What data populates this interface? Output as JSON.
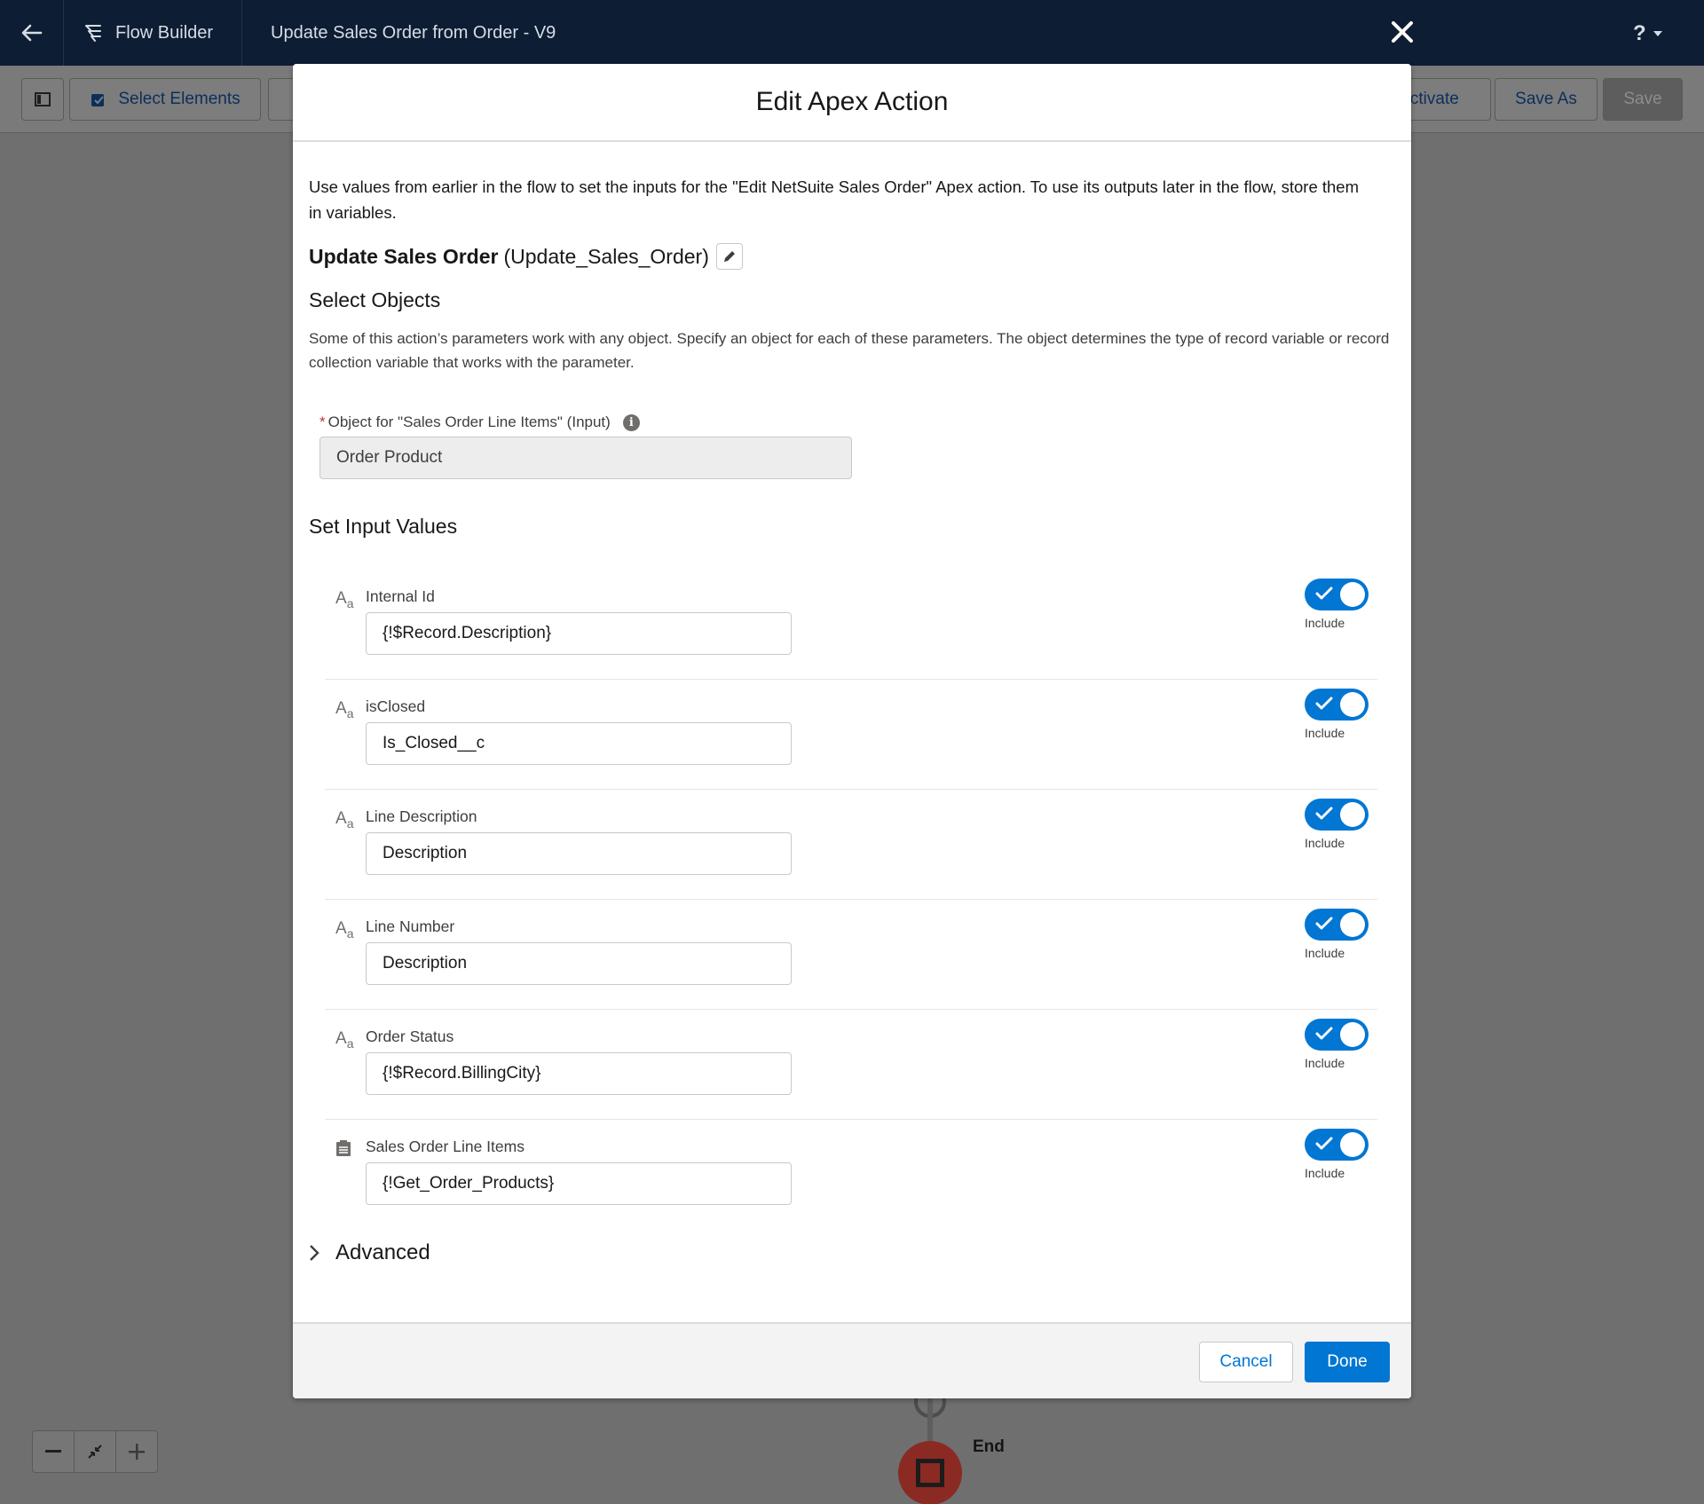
{
  "header": {
    "app_name": "Flow Builder",
    "flow_title": "Update Sales Order from Order - V9",
    "help_label": "?"
  },
  "toolbar": {
    "select_elements": "Select Elements",
    "activate": "Activate",
    "save_as": "Save As",
    "save": "Save"
  },
  "canvas": {
    "end_label": "End"
  },
  "modal": {
    "title": "Edit Apex Action",
    "intro": "Use values from earlier in the flow to set the inputs for the \"Edit NetSuite Sales Order\" Apex action. To use its outputs later in the flow, store them in variables.",
    "element_label": "Update Sales Order",
    "element_api_name": "(Update_Sales_Order)",
    "select_objects_heading": "Select Objects",
    "select_objects_help": "Some of this action’s parameters work with any object. Specify an object for each of these parameters. The object determines the type of record variable or record collection variable that works with the parameter.",
    "object_field_required": "*",
    "object_field_label": "Object for \"Sales Order Line Items\" (Input)",
    "object_field_value": "Order Product",
    "set_inputs_heading": "Set Input Values",
    "parameters": [
      {
        "type_icon": "text-type-icon",
        "label": "Internal Id",
        "value": "{!$Record.Description}",
        "include_label": "Include",
        "included": true
      },
      {
        "type_icon": "text-type-icon",
        "label": "isClosed",
        "value": "Is_Closed__c",
        "include_label": "Include",
        "included": true
      },
      {
        "type_icon": "text-type-icon",
        "label": "Line Description",
        "value": "Description",
        "include_label": "Include",
        "included": true
      },
      {
        "type_icon": "text-type-icon",
        "label": "Line Number",
        "value": "Description",
        "include_label": "Include",
        "included": true
      },
      {
        "type_icon": "text-type-icon",
        "label": "Order Status",
        "value": "{!$Record.BillingCity}",
        "include_label": "Include",
        "included": true
      },
      {
        "type_icon": "collection-icon",
        "label": "Sales Order Line Items",
        "value": "{!Get_Order_Products}",
        "include_label": "Include",
        "included": true
      }
    ],
    "advanced_label": "Advanced",
    "cancel_label": "Cancel",
    "done_label": "Done"
  },
  "colors": {
    "header_bg": "#0d1d33",
    "brand_blue": "#0176d3",
    "overlay": "#6f6f6f",
    "end_node": "#8a2a22"
  }
}
